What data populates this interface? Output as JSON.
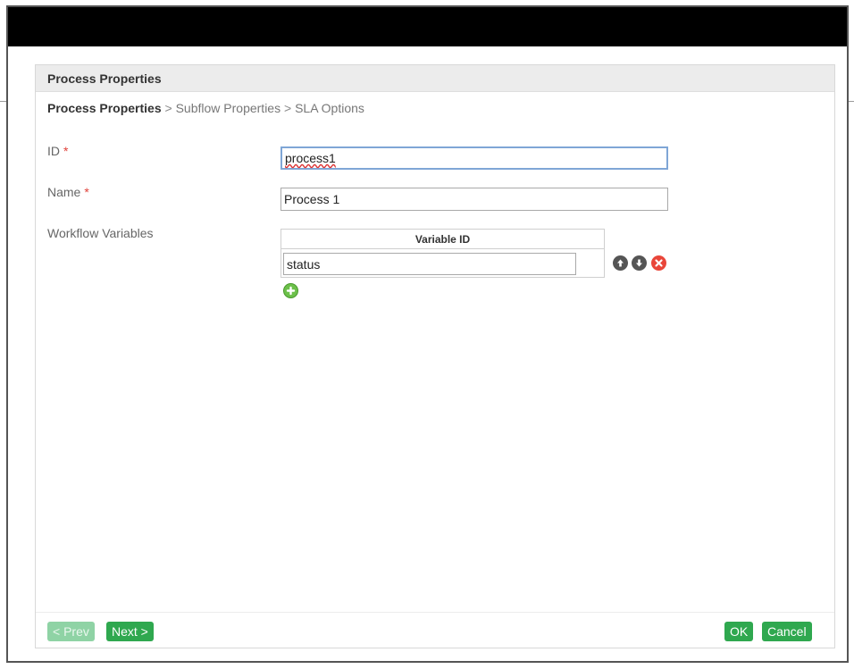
{
  "dialog": {
    "title": "Process Properties",
    "breadcrumb": {
      "current": "Process Properties",
      "separator": ">",
      "steps": [
        "Subflow Properties",
        "SLA Options"
      ]
    }
  },
  "form": {
    "id_label": "ID",
    "id_value": "process1",
    "name_label": "Name",
    "name_value": "Process 1",
    "required_marker": "*",
    "workflow_variables_label": "Workflow Variables",
    "variables_table": {
      "column_header": "Variable ID",
      "rows": [
        {
          "variable_id": "status"
        }
      ]
    }
  },
  "icons": {
    "move_up": "arrow-up-circle-icon",
    "move_down": "arrow-down-circle-icon",
    "delete": "delete-circle-icon",
    "add": "add-circle-icon"
  },
  "buttons": {
    "prev": "< Prev",
    "next": "Next >",
    "ok": "OK",
    "cancel": "Cancel"
  },
  "colors": {
    "accent_green": "#2fa84f",
    "disabled_green": "#8fd3a5",
    "delete_red": "#e9463a",
    "add_green": "#6cc04a",
    "arrow_gray": "#555555",
    "required_red": "#e0413a",
    "titlebar": "#000000"
  }
}
